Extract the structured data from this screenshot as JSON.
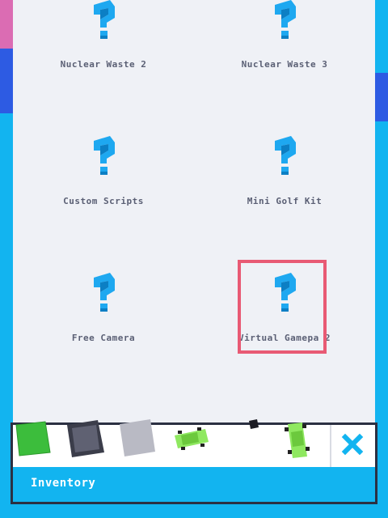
{
  "items": [
    {
      "name": "Nuclear Waste 2",
      "icon": "question-mark-icon"
    },
    {
      "name": "Nuclear Waste 3",
      "icon": "question-mark-icon"
    },
    {
      "name": "Custom Scripts",
      "icon": "question-mark-icon"
    },
    {
      "name": "Mini Golf Kit",
      "icon": "question-mark-icon"
    },
    {
      "name": "Free Camera",
      "icon": "question-mark-icon"
    },
    {
      "name": "Virtual Gamepa 2",
      "icon": "question-mark-icon"
    }
  ],
  "selected_item": "Virtual Gamepa 2",
  "inventory": {
    "label": "Inventory",
    "slots": [
      "green-block-icon",
      "dark-gray-block-icon",
      "light-gray-block-icon",
      "green-car-icon",
      "small-black-block-icon",
      "green-car-icon"
    ],
    "close_icon": "close-icon"
  },
  "colors": {
    "accent": "#12b4f0",
    "icon": "#1ea8f0",
    "selection": "#e85a74",
    "panel": "#eff1f6"
  }
}
